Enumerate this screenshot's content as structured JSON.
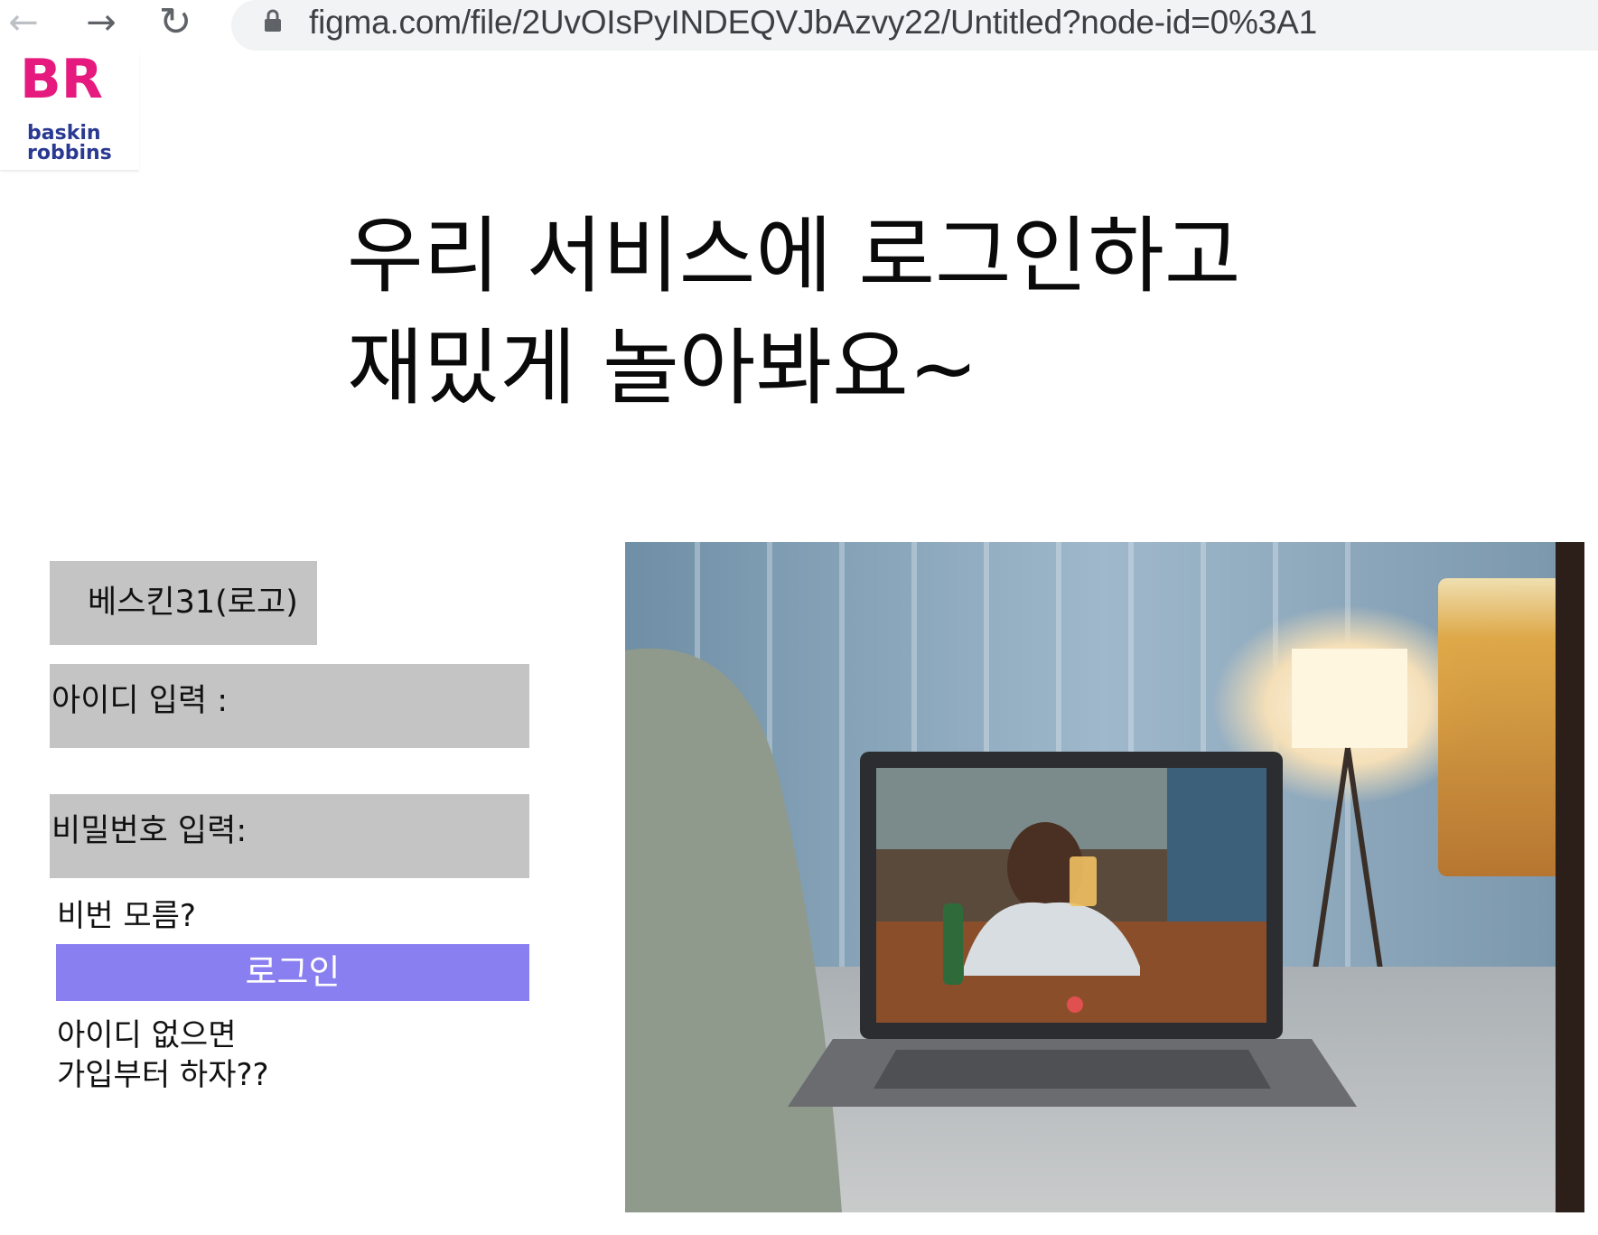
{
  "browser": {
    "url": "figma.com/file/2UvOIsPyINDEQVJbAzvy22/Untitled?node-id=0%3A1"
  },
  "logo": {
    "monogram": "BR",
    "wordmark_line1": "baskin",
    "wordmark_line2": "robbins"
  },
  "headline": {
    "line1": "우리 서비스에 로그인하고",
    "line2": "재밌게 놀아봐요~"
  },
  "login": {
    "brand_label": "베스킨31(로고)",
    "id_label": "아이디 입력 :",
    "password_label": "비밀번호 입력:",
    "forgot_password": "비번 모름?",
    "login_button": "로그인",
    "signup_line1": "아이디 없으면",
    "signup_line2": "가입부터 하자??"
  },
  "colors": {
    "field_background": "#c4c4c4",
    "login_button": "#8a7ff0",
    "logo_pink": "#e5197e",
    "logo_blue": "#2a3991"
  }
}
